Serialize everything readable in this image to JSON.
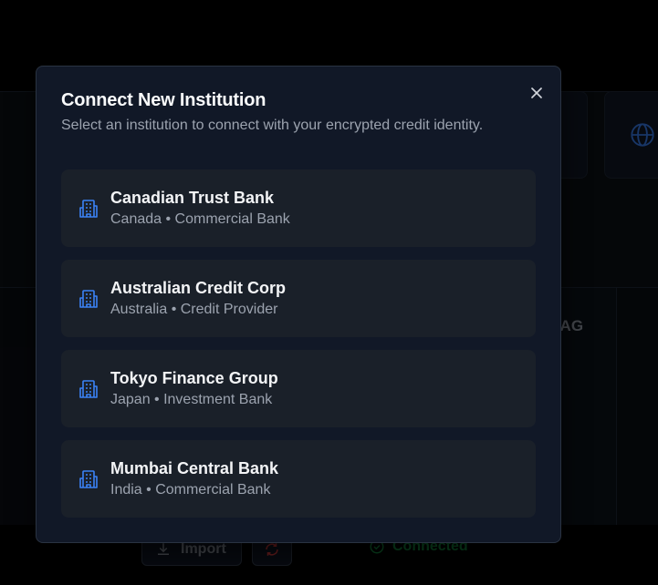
{
  "background": {
    "partial_company": "s AG",
    "import_label": "Import",
    "connected_label": "Connected"
  },
  "modal": {
    "title": "Connect New Institution",
    "subtitle": "Select an institution to connect with your encrypted credit identity.",
    "close_icon": "close-icon",
    "institutions": [
      {
        "name": "Canadian Trust Bank",
        "country": "Canada",
        "type": "Commercial Bank",
        "meta": "Canada • Commercial Bank"
      },
      {
        "name": "Australian Credit Corp",
        "country": "Australia",
        "type": "Credit Provider",
        "meta": "Australia • Credit Provider"
      },
      {
        "name": "Tokyo Finance Group",
        "country": "Japan",
        "type": "Investment Bank",
        "meta": "Japan • Investment Bank"
      },
      {
        "name": "Mumbai Central Bank",
        "country": "India",
        "type": "Commercial Bank",
        "meta": "India • Commercial Bank"
      }
    ]
  },
  "colors": {
    "accent": "#3b82f6",
    "modal_bg": "#111827",
    "item_bg": "#1a2029",
    "success": "#16a34a"
  }
}
